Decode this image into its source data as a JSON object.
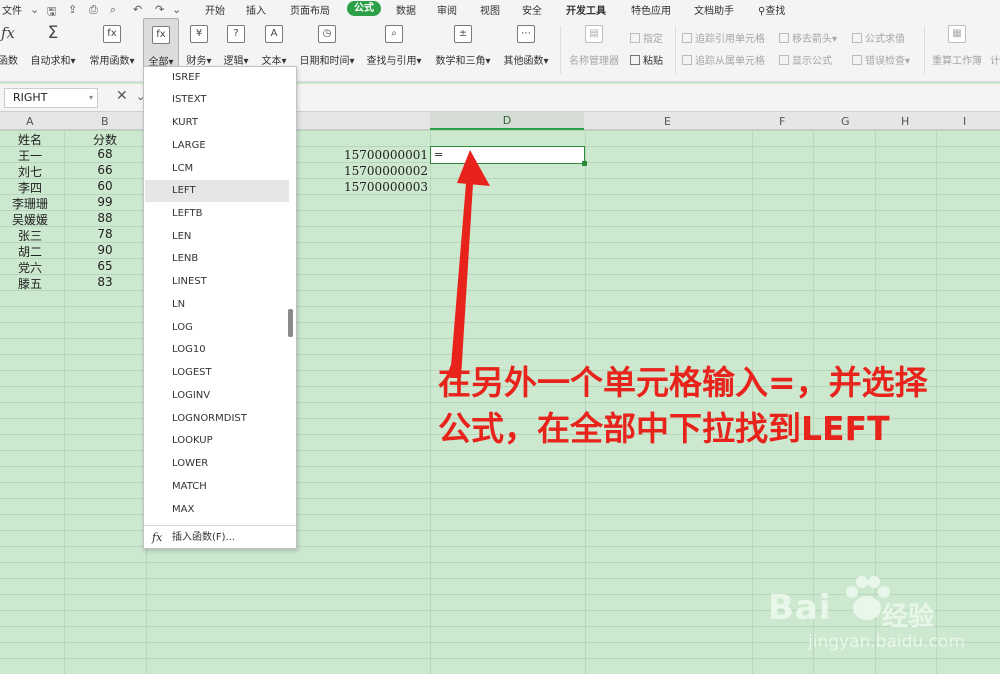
{
  "menubar": {
    "file": "文件",
    "tabs": [
      "开始",
      "插入",
      "页面布局",
      "公式",
      "数据",
      "审阅",
      "视图",
      "安全",
      "开发工具",
      "特色应用",
      "文档助手"
    ],
    "active_tab": "公式",
    "search": "查找"
  },
  "ribbon": {
    "buttons": [
      {
        "label": "函数",
        "icon": "function-icon"
      },
      {
        "label": "自动求和",
        "icon": "sigma-icon"
      },
      {
        "label": "常用函数",
        "icon": "fx-star-icon"
      },
      {
        "label": "全部",
        "icon": "fx-all-icon"
      },
      {
        "label": "财务",
        "icon": "finance-icon"
      },
      {
        "label": "逻辑",
        "icon": "logic-icon"
      },
      {
        "label": "文本",
        "icon": "text-icon"
      },
      {
        "label": "日期和时间",
        "icon": "clock-icon"
      },
      {
        "label": "查找与引用",
        "icon": "lookup-icon"
      },
      {
        "label": "数学和三角",
        "icon": "math-icon"
      },
      {
        "label": "其他函数",
        "icon": "more-functions-icon"
      },
      {
        "label": "名称管理器",
        "icon": "name-manager-icon"
      }
    ],
    "small": {
      "define": "指定",
      "paste": "粘贴",
      "trace_precedents": "追踪引用单元格",
      "trace_dependents": "追踪从属单元格",
      "remove_arrows": "移去箭头",
      "show_formulas": "显示公式",
      "evaluate": "公式求值",
      "error_check": "错误检查",
      "recalc": "重算工作簿",
      "calc_cut": "计"
    }
  },
  "formula_bar": {
    "name_box": "RIGHT"
  },
  "columns": [
    "A",
    "B",
    "D",
    "E",
    "F",
    "G",
    "H",
    "I"
  ],
  "sheet": {
    "names": [
      "姓名",
      "王一",
      "刘七",
      "李四",
      "李珊珊",
      "吴媛媛",
      "张三",
      "胡二",
      "党六",
      "滕五"
    ],
    "scores": [
      "分数",
      "68",
      "66",
      "60",
      "99",
      "88",
      "78",
      "90",
      "65",
      "83"
    ],
    "phones": [
      "15700000001",
      "15700000002",
      "15700000003"
    ],
    "active_cell_value": "="
  },
  "dropdown": {
    "items": [
      "ISREF",
      "ISTEXT",
      "KURT",
      "LARGE",
      "LCM",
      "LEFT",
      "LEFTB",
      "LEN",
      "LENB",
      "LINEST",
      "LN",
      "LOG",
      "LOG10",
      "LOGEST",
      "LOGINV",
      "LOGNORMDIST",
      "LOOKUP",
      "LOWER",
      "MATCH",
      "MAX"
    ],
    "selected": "LEFT",
    "footer": "插入函数(F)..."
  },
  "annotation": {
    "line1": "在另外一个单元格输入=，并选择",
    "line2": "公式，在全部中下拉找到LEFT"
  },
  "watermark": {
    "brand": "Bai",
    "brand_cn": "经验",
    "site": "jingyan.baidu.com"
  }
}
